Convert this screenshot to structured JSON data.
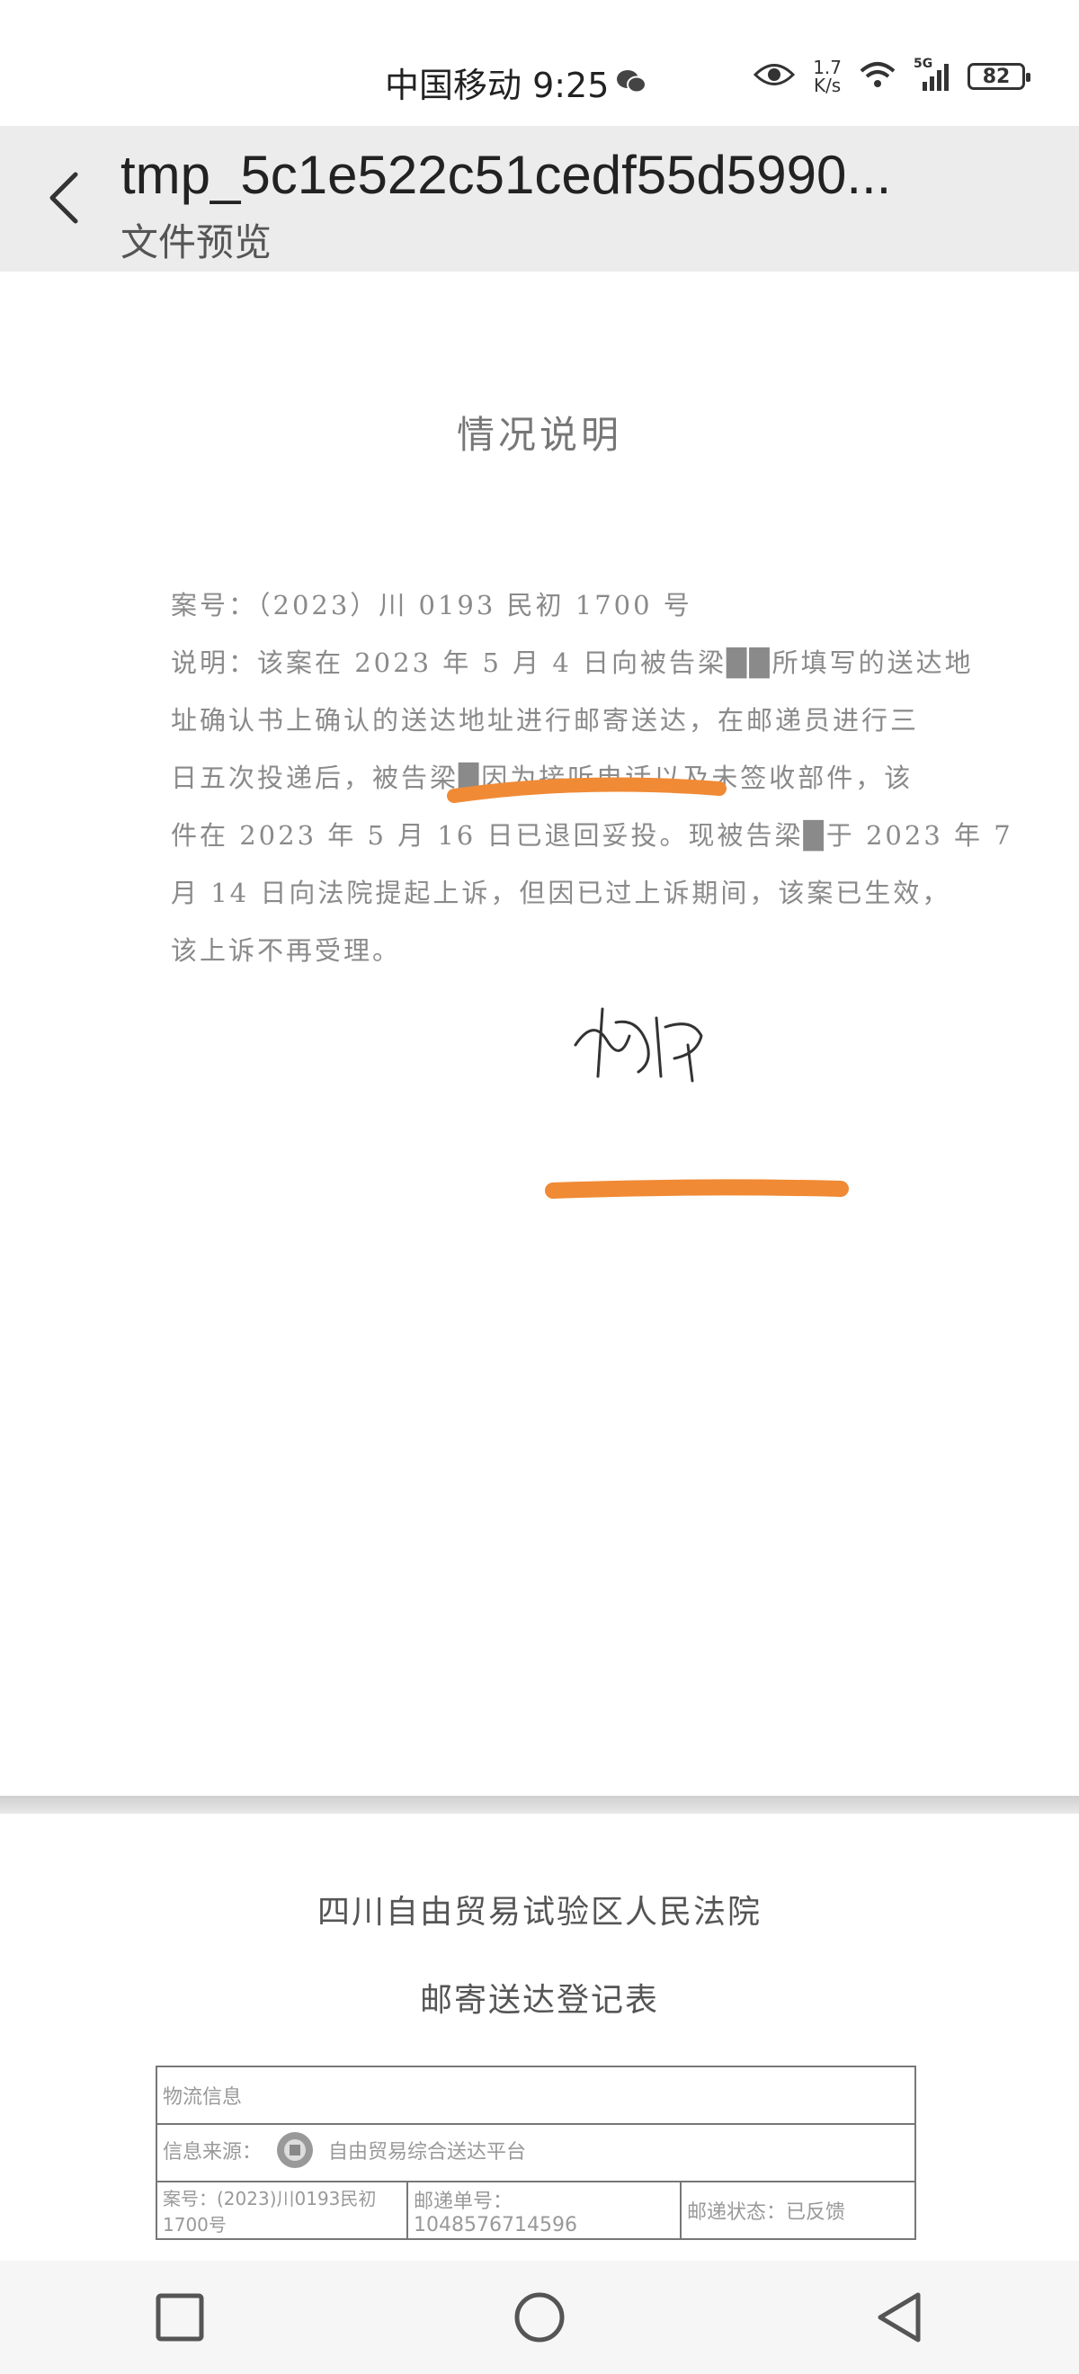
{
  "status_bar": {
    "carrier_time": "中国移动 9:25",
    "net_speed_value": "1.7",
    "net_speed_unit": "K/s",
    "signal_label": "5G",
    "battery": "82"
  },
  "header": {
    "title": "tmp_5c1e522c51cedf55d5990...",
    "subtitle": "文件预览"
  },
  "page1": {
    "title": "情况说明",
    "lines": [
      "案号：（2023）川 0193 民初 1700 号",
      "说明：该案在 2023 年 5 月 4 日向被告梁██所填写的送达地",
      "址确认书上确认的送达地址进行邮寄送达，在邮递员进行三",
      "日五次投递后，被告梁█因为接听电话以及未签收部件，该",
      "件在 2023 年 5 月 16 日已退回妥投。现被告梁█于 2023 年 7",
      "月 14 日向法院提起上诉，但因已过上诉期间，该案已生效，",
      "该上诉不再受理。"
    ],
    "annotation_color": "#f08a35"
  },
  "page2": {
    "court": "四川自由贸易试验区人民法院",
    "form_title": "邮寄送达登记表",
    "row1_label": "物流信息",
    "row2_label": "信息来源：",
    "row2_value": "自由贸易综合送达平台",
    "row3_case": "案号：(2023)川0193民初1700号",
    "row3_tracking": "邮递单号：1048576714596",
    "row3_status": "邮递状态：已反馈"
  }
}
